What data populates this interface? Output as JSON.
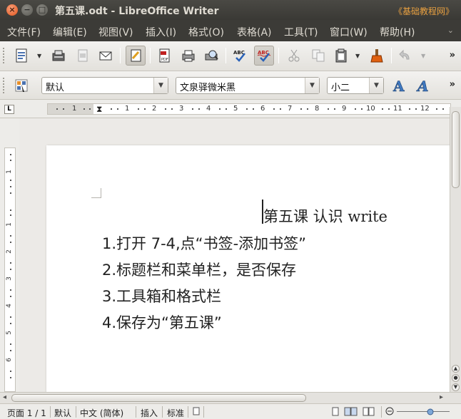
{
  "window": {
    "title": "第五课.odt - LibreOffice Writer",
    "watermark": "《基础教程网》"
  },
  "menu": {
    "items": [
      "文件(F)",
      "编辑(E)",
      "视图(V)",
      "插入(I)",
      "格式(O)",
      "表格(A)",
      "工具(T)",
      "窗口(W)",
      "帮助(H)"
    ]
  },
  "toolbar": {
    "icons": [
      "new-document-icon",
      "save-icon",
      "edit-file-icon",
      "email-icon",
      "edit-mode-icon",
      "export-pdf-icon",
      "print-icon",
      "print-preview-icon",
      "spellcheck-icon",
      "autospellcheck-icon",
      "cut-icon",
      "copy-icon",
      "paste-icon",
      "clone-format-icon",
      "undo-icon"
    ]
  },
  "format_toolbar": {
    "paragraph_style": "默认",
    "font_name": "文泉驿微米黑",
    "font_size": "小二"
  },
  "ruler": {
    "labels": [
      "1",
      "1",
      "2",
      "3",
      "4",
      "5",
      "6",
      "7",
      "8",
      "9",
      "10",
      "11",
      "12"
    ],
    "vlabels": [
      "1",
      "1",
      "2",
      "3",
      "4",
      "5",
      "6"
    ]
  },
  "document": {
    "title": "第五课  认识 write",
    "lines": [
      "1.打开 7-4,点“书签-添加书签”",
      "2.标题栏和菜单栏，是否保存",
      "3.工具箱和格式栏",
      "4.保存为“第五课”"
    ]
  },
  "status": {
    "page": "页面 1 / 1",
    "style": "默认",
    "language": "中文 (简体)",
    "insert_mode": "插入",
    "selection_mode": "标准"
  },
  "colors": {
    "title_bar": "#3c3b37",
    "watermark": "#e8a040",
    "close_button": "#e2541c"
  }
}
